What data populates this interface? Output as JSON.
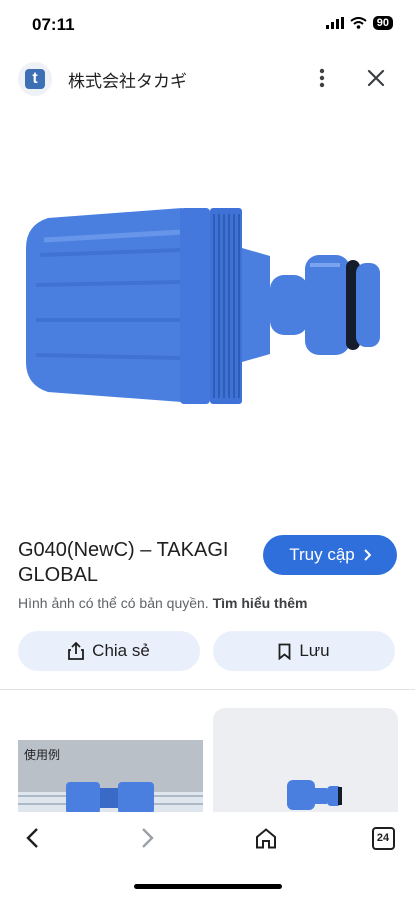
{
  "status": {
    "time": "07:11",
    "battery": "90"
  },
  "header": {
    "site_icon_letter": "t",
    "title": "株式会社タカギ"
  },
  "result": {
    "title": "G040(NewC) – TAKAGI GLOBAL",
    "visit_label": "Truy cập",
    "copyright_text": "Hình ảnh có thể có bản quyền.",
    "learn_more": "Tìm hiểu thêm",
    "share_label": "Chia sẻ",
    "save_label": "Lưu"
  },
  "related": {
    "item1_caption": "使用例"
  },
  "bottom_nav": {
    "tabs_count": "24"
  },
  "colors": {
    "accent": "#2f6fdc",
    "product_blue": "#4a7fe0",
    "chip_bg": "#e9effb"
  }
}
